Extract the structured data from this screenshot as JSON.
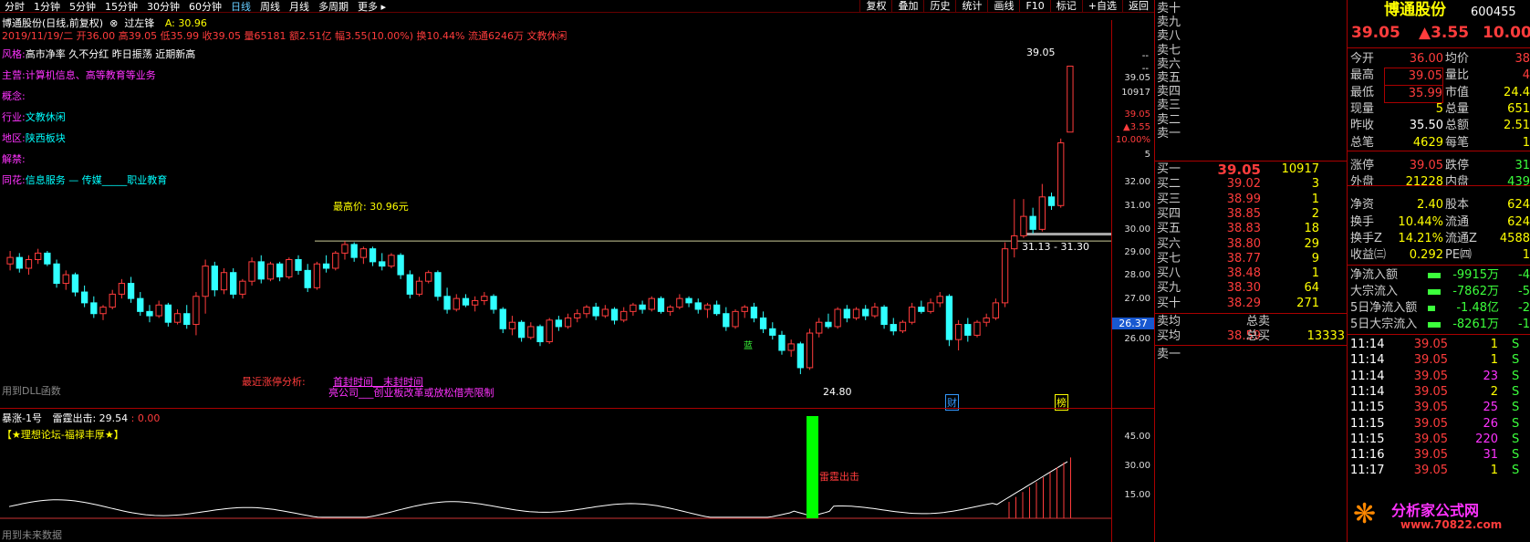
{
  "toolbar": {
    "periods": [
      "分时",
      "1分钟",
      "5分钟",
      "15分钟",
      "30分钟",
      "60分钟",
      "日线",
      "周线",
      "月线",
      "多周期",
      "更多"
    ],
    "active_index": 6,
    "buttons": [
      "复权",
      "叠加",
      "历史",
      "统计",
      "画线",
      "F10",
      "标记",
      "+自选",
      "返回"
    ]
  },
  "header": {
    "title": "博通股份(日线,前复权)",
    "indicator": "过左锋",
    "indicator_value": "A: 30.96",
    "quote_line": "2019/11/19/二 开36.00 高39.05 低35.99 收39.05 量65181 额2.51亿 幅3.55(10.00%) 换10.44% 流通6246万 文教休闲"
  },
  "info": {
    "style_label": "风格:",
    "style_value": "高市净率 久不分红 昨日振荡 近期新高",
    "main_label": "主营:",
    "main_value": "计算机信息、高等教育等业务",
    "concept_label": "概念:",
    "industry_label": "行业:",
    "industry_value": "文教休闲",
    "region_label": "地区:",
    "region_value": "陕西板块",
    "unlock_label": "解禁:",
    "ths_label": "同花:",
    "ths_value": "信息服务 — 传媒_____职业教育",
    "high_price": "最高价: 30.96元",
    "analysis_label": "最近涨停分析:",
    "analysis_1": "首封时间__末封时间",
    "analysis_2": "亮公司___创业板改革或放松借壳限制",
    "dll": "用到DLL函数",
    "future": "用到未来数据",
    "peak_label": "39.05",
    "low_label": "24.80",
    "range_label": "31.13 - 31.30",
    "badge_cai": "财",
    "badge_bang": "榜",
    "ind_badge": "蓝"
  },
  "price_axis": [
    "39.05",
    "10917",
    "39.05",
    "▲3.55",
    "10.00%",
    "5",
    "32.00",
    "31.00",
    "30.00",
    "29.00",
    "28.00",
    "27.00",
    "26.00"
  ],
  "price_axis_current": "26.37",
  "indicator": {
    "name": "暴涨-1号",
    "title": "雷霆出击: 29.54",
    "extra": ": 0.00",
    "forum": "【★理想论坛-福禄丰厚★】",
    "signal": "雷霆出击",
    "axis": [
      "45.00",
      "30.00",
      "15.00"
    ]
  },
  "orderbook": {
    "sells": [
      {
        "label": "卖十",
        "price": "",
        "vol": ""
      },
      {
        "label": "卖九",
        "price": "",
        "vol": ""
      },
      {
        "label": "卖八",
        "price": "",
        "vol": ""
      },
      {
        "label": "卖七",
        "price": "",
        "vol": ""
      },
      {
        "label": "卖六",
        "price": "",
        "vol": ""
      },
      {
        "label": "卖五",
        "price": "",
        "vol": ""
      },
      {
        "label": "卖四",
        "price": "",
        "vol": ""
      },
      {
        "label": "卖三",
        "price": "",
        "vol": ""
      },
      {
        "label": "卖二",
        "price": "",
        "vol": ""
      },
      {
        "label": "卖一",
        "price": "",
        "vol": ""
      }
    ],
    "buys": [
      {
        "label": "买一",
        "price": "39.05",
        "vol": "10917"
      },
      {
        "label": "买二",
        "price": "39.02",
        "vol": "3"
      },
      {
        "label": "买三",
        "price": "38.99",
        "vol": "1"
      },
      {
        "label": "买四",
        "price": "38.85",
        "vol": "2"
      },
      {
        "label": "买五",
        "price": "38.83",
        "vol": "18"
      },
      {
        "label": "买六",
        "price": "38.80",
        "vol": "29"
      },
      {
        "label": "买七",
        "price": "38.77",
        "vol": "9"
      },
      {
        "label": "买八",
        "price": "38.48",
        "vol": "1"
      },
      {
        "label": "买九",
        "price": "38.30",
        "vol": "64"
      },
      {
        "label": "买十",
        "price": "38.29",
        "vol": "271"
      }
    ],
    "avg_sell_label": "卖均",
    "total_sell_label": "总卖",
    "avg_buy_label": "买均",
    "avg_buy_value": "38.59",
    "total_buy_label": "总买",
    "total_buy_value": "13333",
    "sell_one_label": "卖一"
  },
  "quote": {
    "name": "博通股份",
    "code": "600455",
    "price": "39.05",
    "change": "▲3.55",
    "pct": "10.00",
    "rows": [
      [
        "今开",
        "36.00",
        "均价",
        "38"
      ],
      [
        "最高",
        "39.05",
        "量比",
        "4"
      ],
      [
        "最低",
        "35.99",
        "市值",
        "24.4"
      ],
      [
        "现量",
        "5",
        "总量",
        "651"
      ],
      [
        "昨收",
        "35.50",
        "总额",
        "2.51"
      ],
      [
        "总笔",
        "4629",
        "每笔",
        "1"
      ],
      [
        "涨停",
        "39.05",
        "跌停",
        "31"
      ],
      [
        "外盘",
        "21228",
        "内盘",
        "439"
      ],
      [
        "净资",
        "2.40",
        "股本",
        "624"
      ],
      [
        "换手",
        "10.44%",
        "流通",
        "624"
      ],
      [
        "换手Z",
        "14.21%",
        "流通Z",
        "4588"
      ],
      [
        "收益㈢",
        "0.292",
        "PE㈣",
        "1"
      ]
    ],
    "flows": [
      [
        "净流入额",
        "-9915万",
        "-4"
      ],
      [
        "大宗流入",
        "-7862万",
        "-5"
      ],
      [
        "5日净流入额",
        "-1.48亿",
        "-2"
      ],
      [
        "5日大宗流入",
        "-8261万",
        "-1"
      ]
    ],
    "ticks": [
      [
        "11:14",
        "39.05",
        "1",
        "S"
      ],
      [
        "11:14",
        "39.05",
        "1",
        "S"
      ],
      [
        "11:14",
        "39.05",
        "23",
        "S"
      ],
      [
        "11:14",
        "39.05",
        "2",
        "S"
      ],
      [
        "11:15",
        "39.05",
        "25",
        "S"
      ],
      [
        "11:15",
        "39.05",
        "26",
        "S"
      ],
      [
        "11:15",
        "39.05",
        "220",
        "S"
      ],
      [
        "11:16",
        "39.05",
        "31",
        "S"
      ],
      [
        "11:17",
        "39.05",
        "1",
        "S"
      ]
    ],
    "brand": "分析家公式网",
    "brand_url": "www.70822.com"
  },
  "chart_data": {
    "type": "candlestick",
    "ylim": [
      24.0,
      40.0
    ],
    "candles": [
      [
        29.9,
        30.5,
        29.6,
        30.2
      ],
      [
        30.2,
        30.4,
        29.5,
        29.7
      ],
      [
        29.7,
        30.3,
        29.4,
        30.1
      ],
      [
        30.1,
        30.6,
        29.9,
        30.4
      ],
      [
        30.4,
        30.5,
        29.8,
        29.9
      ],
      [
        29.9,
        30.1,
        28.8,
        29.0
      ],
      [
        29.0,
        29.6,
        28.7,
        29.4
      ],
      [
        29.4,
        29.5,
        28.4,
        28.6
      ],
      [
        28.6,
        28.9,
        27.9,
        28.1
      ],
      [
        28.1,
        28.4,
        27.4,
        27.6
      ],
      [
        27.6,
        28.0,
        27.3,
        27.9
      ],
      [
        27.9,
        28.7,
        27.8,
        28.5
      ],
      [
        28.5,
        29.2,
        28.3,
        29.0
      ],
      [
        29.0,
        29.3,
        28.1,
        28.3
      ],
      [
        28.3,
        28.6,
        27.5,
        27.7
      ],
      [
        27.7,
        28.0,
        27.2,
        27.5
      ],
      [
        27.5,
        28.2,
        27.4,
        28.0
      ],
      [
        28.0,
        28.1,
        27.0,
        27.2
      ],
      [
        27.2,
        27.8,
        27.1,
        27.6
      ],
      [
        27.6,
        28.0,
        26.9,
        27.1
      ],
      [
        27.1,
        28.6,
        26.6,
        28.4
      ],
      [
        28.4,
        30.1,
        27.6,
        29.8
      ],
      [
        29.8,
        30.0,
        28.4,
        28.7
      ],
      [
        28.7,
        29.7,
        28.5,
        29.5
      ],
      [
        29.5,
        29.7,
        28.3,
        28.5
      ],
      [
        28.5,
        29.2,
        28.3,
        29.1
      ],
      [
        29.1,
        30.2,
        28.9,
        30.0
      ],
      [
        30.0,
        30.3,
        29.0,
        29.2
      ],
      [
        29.2,
        30.0,
        29.1,
        29.9
      ],
      [
        29.9,
        30.0,
        29.1,
        29.3
      ],
      [
        29.3,
        30.2,
        29.2,
        30.1
      ],
      [
        30.1,
        30.3,
        29.4,
        29.6
      ],
      [
        29.6,
        29.9,
        28.6,
        28.8
      ],
      [
        28.8,
        30.0,
        28.7,
        29.9
      ],
      [
        29.9,
        30.3,
        29.5,
        29.7
      ],
      [
        29.7,
        30.5,
        29.6,
        30.4
      ],
      [
        30.4,
        30.96,
        30.1,
        30.8
      ],
      [
        30.8,
        30.9,
        30.0,
        30.2
      ],
      [
        30.2,
        30.7,
        29.9,
        30.6
      ],
      [
        30.6,
        30.7,
        29.8,
        30.0
      ],
      [
        30.0,
        30.4,
        29.6,
        29.8
      ],
      [
        29.8,
        30.4,
        29.7,
        30.3
      ],
      [
        30.3,
        30.4,
        29.2,
        29.4
      ],
      [
        29.4,
        29.6,
        28.3,
        28.5
      ],
      [
        28.5,
        29.3,
        28.4,
        29.1
      ],
      [
        29.1,
        29.6,
        29.0,
        29.5
      ],
      [
        29.5,
        29.6,
        28.2,
        28.4
      ],
      [
        28.4,
        28.8,
        27.6,
        27.8
      ],
      [
        27.8,
        28.5,
        27.7,
        28.3
      ],
      [
        28.3,
        28.5,
        27.9,
        28.0
      ],
      [
        28.0,
        28.4,
        27.7,
        28.2
      ],
      [
        28.2,
        28.6,
        28.0,
        28.4
      ],
      [
        28.4,
        28.5,
        27.6,
        27.8
      ],
      [
        27.8,
        27.9,
        26.7,
        26.9
      ],
      [
        26.9,
        27.5,
        26.6,
        27.2
      ],
      [
        27.2,
        27.3,
        26.3,
        26.5
      ],
      [
        26.5,
        27.2,
        26.4,
        27.0
      ],
      [
        27.0,
        27.1,
        26.1,
        26.3
      ],
      [
        26.3,
        27.4,
        26.2,
        27.3
      ],
      [
        27.3,
        27.5,
        26.8,
        27.0
      ],
      [
        27.0,
        27.6,
        26.9,
        27.4
      ],
      [
        27.4,
        27.8,
        27.2,
        27.6
      ],
      [
        27.6,
        28.0,
        27.4,
        27.9
      ],
      [
        27.9,
        28.1,
        27.3,
        27.5
      ],
      [
        27.5,
        28.0,
        27.4,
        27.8
      ],
      [
        27.8,
        27.9,
        27.1,
        27.3
      ],
      [
        27.3,
        27.9,
        27.2,
        27.7
      ],
      [
        27.7,
        28.1,
        27.5,
        28.0
      ],
      [
        28.0,
        28.2,
        27.6,
        27.8
      ],
      [
        27.8,
        28.4,
        27.7,
        28.3
      ],
      [
        28.3,
        28.4,
        27.6,
        27.7
      ],
      [
        27.7,
        28.0,
        27.5,
        27.9
      ],
      [
        27.9,
        28.5,
        27.8,
        28.3
      ],
      [
        28.3,
        28.4,
        27.9,
        28.1
      ],
      [
        28.1,
        28.3,
        27.6,
        27.8
      ],
      [
        27.8,
        28.1,
        27.4,
        28.0
      ],
      [
        28.0,
        28.2,
        27.5,
        27.6
      ],
      [
        27.6,
        27.9,
        26.8,
        27.0
      ],
      [
        27.0,
        27.8,
        26.9,
        27.7
      ],
      [
        27.7,
        28.0,
        27.4,
        27.9
      ],
      [
        27.9,
        28.1,
        27.2,
        27.4
      ],
      [
        27.4,
        27.7,
        26.7,
        26.9
      ],
      [
        26.9,
        27.2,
        26.4,
        26.6
      ],
      [
        26.6,
        26.8,
        25.7,
        25.9
      ],
      [
        25.9,
        26.4,
        25.6,
        26.2
      ],
      [
        26.2,
        26.3,
        24.8,
        25.1
      ],
      [
        25.1,
        26.9,
        25.0,
        26.7
      ],
      [
        26.7,
        27.4,
        26.5,
        27.2
      ],
      [
        27.2,
        27.6,
        26.9,
        27.0
      ],
      [
        27.0,
        27.9,
        26.9,
        27.8
      ],
      [
        27.8,
        28.0,
        27.2,
        27.4
      ],
      [
        27.4,
        27.9,
        27.3,
        27.8
      ],
      [
        27.8,
        28.0,
        27.3,
        27.5
      ],
      [
        27.5,
        28.1,
        27.4,
        27.9
      ],
      [
        27.9,
        28.0,
        26.9,
        27.1
      ],
      [
        27.1,
        27.4,
        26.6,
        26.8
      ],
      [
        26.8,
        27.3,
        26.7,
        27.2
      ],
      [
        27.2,
        28.1,
        27.1,
        27.9
      ],
      [
        27.9,
        28.2,
        27.6,
        27.7
      ],
      [
        27.7,
        28.3,
        27.6,
        28.1
      ],
      [
        28.1,
        28.6,
        27.9,
        28.4
      ],
      [
        28.4,
        28.5,
        26.1,
        26.4
      ],
      [
        26.4,
        27.3,
        25.9,
        27.1
      ],
      [
        27.1,
        27.4,
        26.3,
        26.6
      ],
      [
        26.6,
        27.3,
        26.5,
        27.2
      ],
      [
        27.2,
        27.6,
        27.0,
        27.4
      ],
      [
        27.4,
        28.3,
        27.3,
        28.1
      ],
      [
        28.1,
        30.9,
        27.9,
        30.6
      ],
      [
        30.6,
        32.9,
        30.2,
        31.2
      ],
      [
        31.2,
        32.9,
        31.1,
        32.1
      ],
      [
        32.1,
        32.5,
        31.3,
        31.5
      ],
      [
        31.5,
        33.6,
        31.4,
        33.0
      ],
      [
        33.0,
        33.2,
        32.4,
        32.6
      ],
      [
        32.6,
        35.7,
        32.5,
        35.5
      ],
      [
        36.0,
        39.05,
        35.99,
        39.05
      ]
    ]
  }
}
